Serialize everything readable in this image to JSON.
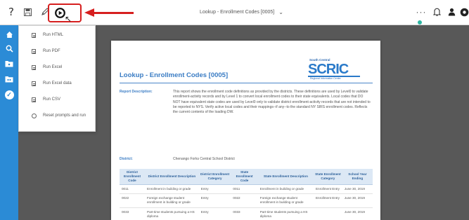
{
  "toolbar": {
    "help_glyph": "?",
    "title": "Lookup - Enrollment Codes [0005]",
    "more_glyph": "···"
  },
  "menu": {
    "items": [
      {
        "label": "Run HTML"
      },
      {
        "label": "Run PDF"
      },
      {
        "label": "Run Excel"
      },
      {
        "label": "Run Excel data"
      },
      {
        "label": "Run CSV"
      },
      {
        "label": "Reset prompts and run"
      }
    ]
  },
  "report": {
    "title": "Lookup - Enrollment Codes [0005]",
    "logo": {
      "top": "South Central",
      "main": "SCRIC",
      "sub": "Regional Information Center"
    },
    "description_label": "Report Description:",
    "description": "This report shows the enrollment code definitions as provided by the districts. These definitions are used by Level0 to validate enrollment-activity records and by Level 1 to convert local enrollment codes to their state equivalents. Local codes that DO NOT have equivalent state codes are used by Level0 only to validate district enrollment-activity records that are not intended to be reported to NYS. Verify active local codes and their mappings--if any--to the standard NY SIRS enrollment codes. Reflects the current contents of the loading DW.",
    "district_label": "District:",
    "district_value": "Chenango Forks Central School District",
    "table": {
      "headers": [
        "District Enrollment Code",
        "District Enrollment Description",
        "District Enrollment Category",
        "State Enrollment Code",
        "State Enrollment Description",
        "State Enrollment Category",
        "School Year Ending"
      ],
      "rows": [
        [
          "0011",
          "Enrollment in building or grade",
          "Entry",
          "0011",
          "Enrollment in building or grade",
          "Enrollment Entry",
          "June 30, 2019"
        ],
        [
          "0022",
          "Foreign exchange student enrollment in building or grade",
          "Entry",
          "0022",
          "Foreign exchange student enrollment in building or grade",
          "Enrollment Entry",
          "June 30, 2019"
        ],
        [
          "0033",
          "Part-time students pursuing a HS diploma",
          "Entry",
          "0033",
          "Part-time students pursuing a HS diploma",
          "",
          "June 30, 2019"
        ]
      ]
    }
  },
  "colors": {
    "sidebar": "#2b8bd6",
    "highlight": "#d61f1f",
    "viewer_bg": "#585858",
    "report_accent": "#3a7cc4",
    "status_dot": "#2db6a3"
  },
  "icons": {
    "toolbar": [
      "help-icon",
      "save-icon",
      "edit-icon",
      "run-icon",
      "more-icon",
      "bell-icon",
      "user-icon",
      "settings-icon"
    ],
    "sidebar": [
      "home-icon",
      "search-icon",
      "folder-icon",
      "team-folder-icon",
      "check-circle-icon"
    ]
  }
}
